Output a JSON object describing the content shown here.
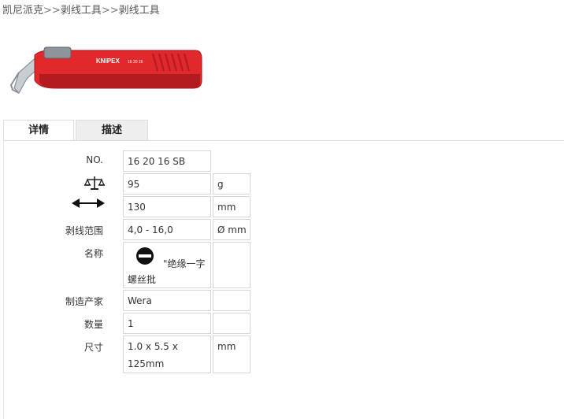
{
  "breadcrumb": {
    "items": [
      "凯尼派克",
      "剥线工具",
      "剥线工具"
    ],
    "separator": ">>"
  },
  "product": {
    "brand_on_tool": "KNIPEX",
    "model_on_tool": "16 20 16"
  },
  "tabs": [
    {
      "label": "详情",
      "active": true
    },
    {
      "label": "描述",
      "active": false
    }
  ],
  "specs": {
    "no_label": "NO.",
    "no_value": "16 20 16 SB",
    "weight_icon": "balance-scale-icon",
    "weight_value": "95",
    "weight_unit": "g",
    "length_icon": "double-arrow-icon",
    "length_value": "130",
    "length_unit": "mm",
    "range_label": "剥线范围",
    "range_value": "4,0 - 16,0",
    "range_unit": "Ø mm",
    "name_label": "名称",
    "name_icon": "slotted-screw-icon",
    "name_value_line1": "\"绝缘一字",
    "name_value_line2": "螺丝批",
    "maker_label": "制造产家",
    "maker_value": "Wera",
    "qty_label": "数量",
    "qty_value": "1",
    "size_label": "尺寸",
    "size_value_line1": "1.0 x 5.5 x",
    "size_value_line2": "125mm",
    "size_unit": "mm"
  },
  "colors": {
    "tool_red": "#e0282d",
    "tool_dark_red": "#b31b1f",
    "tab_inactive_bg": "#eeeeee",
    "border": "#d6d6d6"
  }
}
